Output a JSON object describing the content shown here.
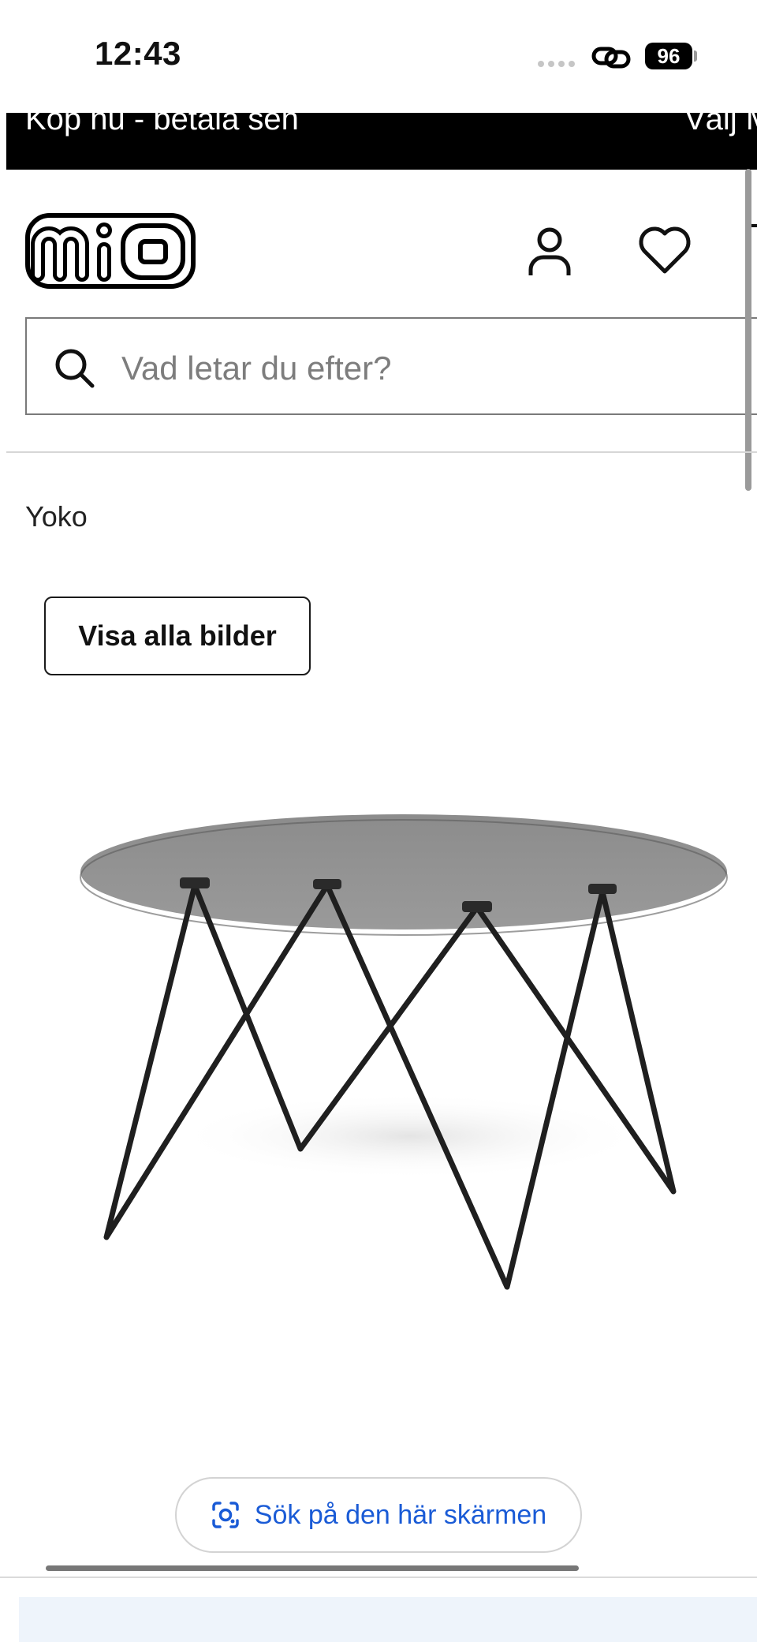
{
  "status_bar": {
    "time": "12:43",
    "battery": "96"
  },
  "promo_banner": {
    "left_text": "Köp nu - betala sen",
    "right_text": "Välj M"
  },
  "header": {
    "logo_text": "mio",
    "icons": [
      "account-icon",
      "heart-icon"
    ]
  },
  "search": {
    "placeholder": "Vad letar du efter?"
  },
  "breadcrumb": "Yoko",
  "gallery": {
    "button_label": "Visa alla bilder"
  },
  "lens_bar": {
    "label": "Sök på den här skärmen"
  },
  "colors": {
    "banner_bg": "#000000",
    "lens_text": "#1a5bd6",
    "bottom_panel": "#eef4fb"
  }
}
